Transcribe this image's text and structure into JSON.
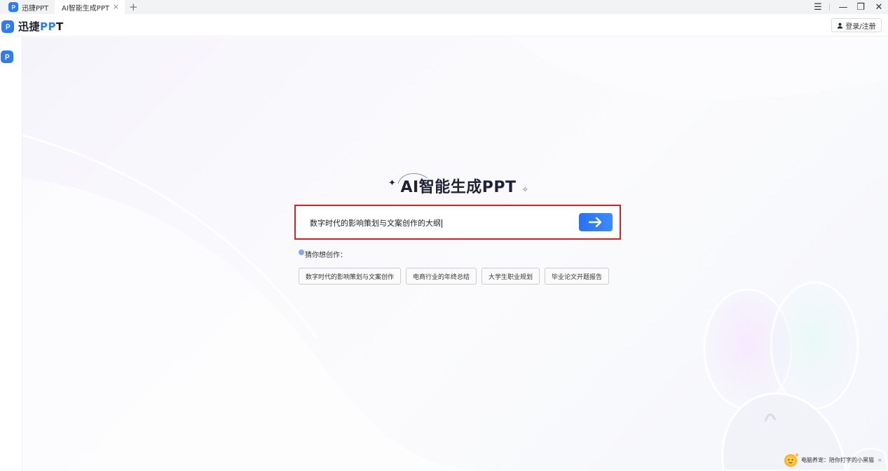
{
  "tabs": [
    {
      "label": "迅捷PPT"
    },
    {
      "label": "AI智能生成PPT",
      "close": "×"
    }
  ],
  "tab_add": "+",
  "window_controls": {
    "menu": "☰",
    "minimize": "—",
    "restore": "❐",
    "close": "✕"
  },
  "header": {
    "brand_prefix": "迅捷",
    "brand_suffix_blue": "PP",
    "brand_suffix_end": "T",
    "login_label": "登录/注册"
  },
  "main": {
    "title": "AI智能生成PPT",
    "search_value": "数字时代的影响策划与文案创作的大纲",
    "guess_label": "猜你想创作：",
    "suggestions": [
      "数字时代的影响策划与文案创作",
      "电商行业的年终总结",
      "大学生职业规划",
      "毕业论文开题报告"
    ]
  },
  "notification": {
    "text": "电脑养宠：陪你打字的小黑猫",
    "close": "×"
  },
  "colors": {
    "accent": "#2f7bf5",
    "highlight_border": "#e02020",
    "title": "#1e2236"
  }
}
